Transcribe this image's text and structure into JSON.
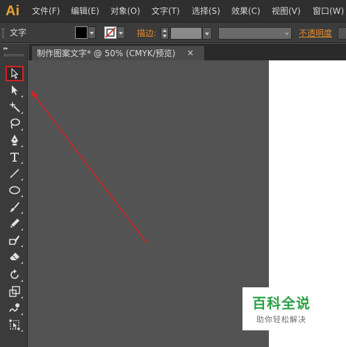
{
  "app": {
    "logo": "Ai"
  },
  "menu": {
    "items": [
      {
        "label": "文件(F)"
      },
      {
        "label": "编辑(E)"
      },
      {
        "label": "对象(O)"
      },
      {
        "label": "文字(T)"
      },
      {
        "label": "选择(S)"
      },
      {
        "label": "效果(C)"
      },
      {
        "label": "视图(V)"
      },
      {
        "label": "窗口(W)"
      }
    ]
  },
  "control_bar": {
    "current_tool": "文字",
    "fill_color": "#000000",
    "stroke_color": "none",
    "stroke_label": "描边:",
    "opacity_label": "不透明度"
  },
  "document": {
    "tab_title": "制作图案文字* @ 50% (CMYK/预览)",
    "close_glyph": "×"
  },
  "toolbar": {
    "collapse_glyph": "▸▸",
    "tools": [
      {
        "name": "selection-tool",
        "icon": "selection-arrow-icon",
        "active": true
      },
      {
        "name": "direct-selection-tool",
        "icon": "direct-selection-icon"
      },
      {
        "name": "magic-wand-tool",
        "icon": "magic-wand-icon"
      },
      {
        "name": "lasso-tool",
        "icon": "lasso-icon"
      },
      {
        "name": "pen-tool",
        "icon": "pen-icon"
      },
      {
        "name": "type-tool",
        "icon": "type-icon"
      },
      {
        "name": "line-tool",
        "icon": "line-segment-icon"
      },
      {
        "name": "ellipse-tool",
        "icon": "ellipse-icon"
      },
      {
        "name": "paintbrush-tool",
        "icon": "paintbrush-icon"
      },
      {
        "name": "pencil-tool",
        "icon": "pencil-icon"
      },
      {
        "name": "blob-brush-tool",
        "icon": "blob-brush-icon"
      },
      {
        "name": "eraser-tool",
        "icon": "eraser-icon"
      },
      {
        "name": "rotate-tool",
        "icon": "rotate-icon"
      },
      {
        "name": "scale-tool",
        "icon": "scale-icon"
      },
      {
        "name": "warp-tool",
        "icon": "warp-icon"
      },
      {
        "name": "free-transform-tool",
        "icon": "free-transform-icon"
      }
    ]
  },
  "annotation": {
    "color": "#d42323"
  },
  "watermark": {
    "title": "百科全说",
    "subtitle": "助你轻松解决",
    "color": "#2aa146"
  }
}
